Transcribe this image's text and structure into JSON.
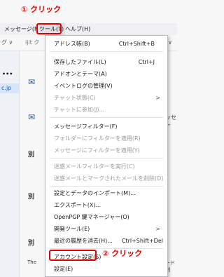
{
  "callouts": {
    "step1": "① クリック",
    "step2": "② クリック"
  },
  "menubar": {
    "items": [
      "メッセージ(M)",
      "ツール(T)",
      "ヘルプ(H)"
    ]
  },
  "toolbar": {
    "left": "グ ∨",
    "user": "ijit ク",
    "right": "∨"
  },
  "leftpane": {
    "dots": "•••",
    "account": "c.jp"
  },
  "content": {
    "hint1": "別",
    "hint2": "別",
    "hint3": "別",
    "frag_right": "ッセー",
    "frag_right2": "ード制",
    "frag_bottom": "The"
  },
  "tools_menu": {
    "items": [
      {
        "label": "アドレス帳(B)",
        "shortcut": "Ctrl+Shift+B"
      },
      {
        "label": "保存したファイル(L)",
        "shortcut": "Ctrl+J"
      },
      {
        "label": "アドオンとテーマ(A)",
        "shortcut": ""
      },
      {
        "label": "イベントログの管理(V)",
        "shortcut": ""
      },
      {
        "label": "チャット状態(C)",
        "shortcut": ""
      },
      {
        "label": "チャットに参加(J)...",
        "shortcut": ""
      },
      {
        "label": "メッセージフィルター(F)",
        "shortcut": ""
      },
      {
        "label": "フォルダーにフィルターを適用(R)",
        "shortcut": ""
      },
      {
        "label": "メッセージにフィルターを適用(Y)",
        "shortcut": ""
      },
      {
        "label": "迷惑メールフィルターを実行(C)",
        "shortcut": ""
      },
      {
        "label": "迷惑メールとマークされたメールを削除(D)",
        "shortcut": ""
      },
      {
        "label": "設定とデータのインポート(M)...",
        "shortcut": ""
      },
      {
        "label": "エクスポート(X)...",
        "shortcut": ""
      },
      {
        "label": "OpenPGP 鍵マネージャー(O)",
        "shortcut": ""
      },
      {
        "label": "開発ツール(E)",
        "shortcut": ""
      },
      {
        "label": "最近の履歴を消去(H)...",
        "shortcut": "Ctrl+Shift+Del"
      },
      {
        "label": "アカウント設定(S)",
        "shortcut": ""
      },
      {
        "label": "設定(E)",
        "shortcut": ""
      }
    ],
    "submenu_arrow": ">"
  },
  "colors": {
    "highlight": "#e60000",
    "menu_bg": "#ffffff",
    "disabled_text": "#9a9a9a"
  }
}
